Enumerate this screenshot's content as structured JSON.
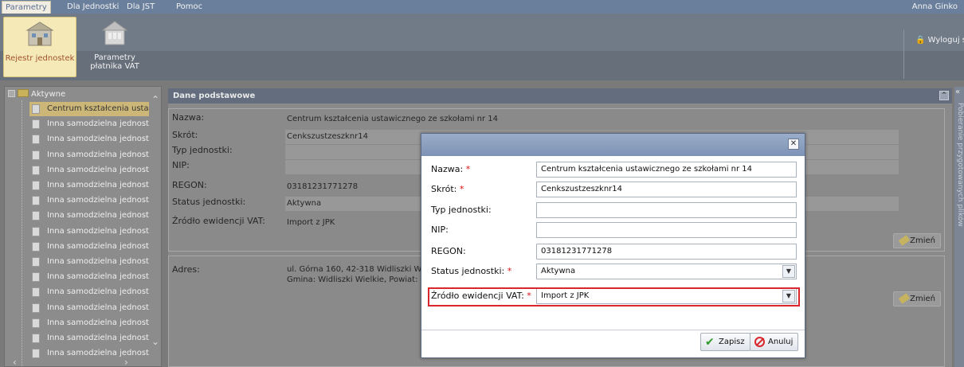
{
  "menubar": {
    "tabs": [
      "Parametry",
      "Dla Jednostki",
      "Dla JST",
      "Pomoc"
    ],
    "user": "Anna Ginko"
  },
  "ribbon": {
    "buttons": [
      {
        "label": "Rejestr jednostek",
        "icon": "register-buildings-icon"
      },
      {
        "label": "Parametry płatnika VAT",
        "icon": "vat-building-icon"
      }
    ],
    "logout_label": "Wyloguj s"
  },
  "tree": {
    "root_label": "Aktywne",
    "items": [
      "Centrum kształcenia ustaw",
      "Inna samodzielna jednostk",
      "Inna samodzielna jednostk",
      "Inna samodzielna jednostk",
      "Inna samodzielna jednostk",
      "Inna samodzielna jednostk",
      "Inna samodzielna jednostk",
      "Inna samodzielna jednostk",
      "Inna samodzielna jednostk",
      "Inna samodzielna jednostk",
      "Inna samodzielna jednostk",
      "Inna samodzielna jednostk",
      "Inna samodzielna jednostk",
      "Inna samodzielna jednostk",
      "Inna samodzielna jednostk",
      "Inna samodzielna jednostk",
      "Inna samodzielna jednostk"
    ]
  },
  "panel": {
    "title": "Dane podstawowe",
    "rows": [
      {
        "label": "Nazwa:",
        "value": "Centrum kształcenia ustawicznego ze szkołami nr 14"
      },
      {
        "label": "Skrót:",
        "value": "Cenkszustzeszknr14"
      },
      {
        "label": "Typ jednostki:",
        "value": ""
      },
      {
        "label": "NIP:",
        "value": ""
      },
      {
        "label": "REGON:",
        "value": "03181231771278"
      },
      {
        "label": "Status jednostki:",
        "value": "Aktywna"
      },
      {
        "label": "Źródło ewidencji VAT:",
        "value": "Import z JPK"
      }
    ],
    "address_label": "Adres:",
    "address_line1": "ul. Górna 160, 42-318 Widliszki W",
    "address_line2": "Gmina: Widliszki Wielkie, Powiat:",
    "edit_label": "Zmień",
    "side_panel_label": "Pobieranie przygotowanych plików"
  },
  "modal": {
    "fields": [
      {
        "label": "Nazwa:",
        "required": "*",
        "value": "Centrum kształcenia ustawicznego ze szkołami nr 14"
      },
      {
        "label": "Skrót:",
        "required": "*",
        "value": "Cenkszustzeszknr14"
      },
      {
        "label": "Typ jednostki:",
        "required": "",
        "value": ""
      },
      {
        "label": "NIP:",
        "required": "",
        "value": ""
      },
      {
        "label": "REGON:",
        "required": "",
        "value": "03181231771278"
      },
      {
        "label": "Status jednostki:",
        "required": "*",
        "value": "Aktywna"
      },
      {
        "label": "Źródło ewidencji VAT:",
        "required": "*",
        "value": "Import z JPK"
      }
    ],
    "save_label": "Zapisz",
    "cancel_label": "Anuluj"
  },
  "colors": {
    "highlight": "#d9272d",
    "required": "#dd1111",
    "selected_tree": "#cdb778"
  }
}
